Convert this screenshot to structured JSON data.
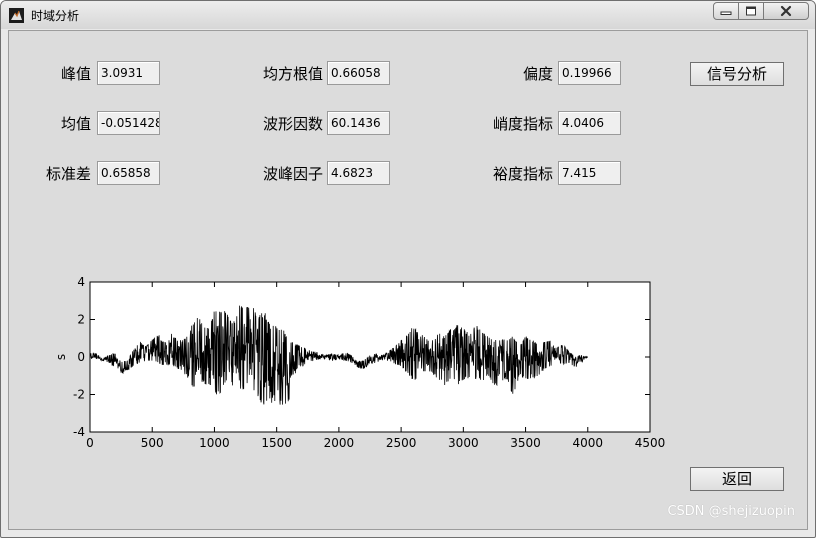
{
  "window": {
    "title": "时域分析"
  },
  "metrics": [
    {
      "label": "峰值",
      "value": "3.0931"
    },
    {
      "label": "均方根值",
      "value": "0.66058"
    },
    {
      "label": "偏度",
      "value": "0.19966"
    },
    {
      "label": "均值",
      "value": "-0.051428"
    },
    {
      "label": "波形因数",
      "value": "60.1436"
    },
    {
      "label": "峭度指标",
      "value": "4.0406"
    },
    {
      "label": "标准差",
      "value": "0.65858"
    },
    {
      "label": "波峰因子",
      "value": "4.6823"
    },
    {
      "label": "裕度指标",
      "value": "7.415"
    }
  ],
  "buttons": {
    "analyze": "信号分析",
    "back": "返回"
  },
  "watermark": "CSDN @shejizuopin",
  "chart_data": {
    "type": "line",
    "ylabel": "s",
    "xlim": [
      0,
      4500
    ],
    "ylim": [
      -4,
      4
    ],
    "x_ticks": [
      0,
      500,
      1000,
      1500,
      2000,
      2500,
      3000,
      3500,
      4000,
      4500
    ],
    "y_ticks": [
      4,
      2,
      0,
      -2,
      -4
    ],
    "x_tick_labels": [
      "0",
      "500",
      "1000",
      "1500",
      "2000",
      "2500",
      "3000",
      "3500",
      "4000",
      "4500"
    ],
    "y_tick_labels": [
      "4",
      "2",
      "0",
      "-2",
      "-4"
    ],
    "grid": false,
    "series": [
      {
        "color": "#000000",
        "x": [
          0,
          50,
          100,
          150,
          200,
          250,
          300,
          350,
          400,
          450,
          500,
          550,
          600,
          650,
          700,
          750,
          800,
          850,
          900,
          950,
          1000,
          1050,
          1100,
          1150,
          1200,
          1250,
          1300,
          1350,
          1400,
          1450,
          1500,
          1550,
          1600,
          1650,
          1700,
          1750,
          1800,
          1850,
          1900,
          1950,
          2000,
          2050,
          2100,
          2150,
          2200,
          2250,
          2300,
          2350,
          2400,
          2450,
          2500,
          2550,
          2600,
          2650,
          2700,
          2750,
          2800,
          2850,
          2900,
          2950,
          3000,
          3050,
          3100,
          3150,
          3200,
          3250,
          3300,
          3350,
          3400,
          3450,
          3500,
          3550,
          3600,
          3650,
          3700,
          3750,
          3800,
          3850,
          3900,
          3950,
          4000
        ],
        "y_upper": [
          0.2,
          0.2,
          -0.1,
          0.1,
          0.2,
          -0.3,
          -0.2,
          0.4,
          0.9,
          0.6,
          1.0,
          1.2,
          0.8,
          1.3,
          1.0,
          0.9,
          1.5,
          2.2,
          2.0,
          1.5,
          2.5,
          2.6,
          2.4,
          1.8,
          2.8,
          3.1,
          2.9,
          2.2,
          2.5,
          1.7,
          1.8,
          1.5,
          0.9,
          0.7,
          0.6,
          0.4,
          0.3,
          0.2,
          0.1,
          0.2,
          0.1,
          0.3,
          0.1,
          -0.3,
          -0.2,
          0.1,
          0.2,
          0.1,
          0.3,
          0.6,
          0.9,
          1.2,
          1.7,
          1.3,
          1.0,
          0.9,
          1.3,
          1.1,
          1.5,
          1.9,
          1.6,
          1.2,
          1.8,
          1.4,
          1.1,
          0.9,
          1.0,
          0.9,
          1.2,
          0.6,
          1.1,
          1.0,
          0.7,
          0.8,
          0.9,
          0.5,
          0.7,
          0.3,
          0.0,
          0.1,
          0.0
        ],
        "y_lower": [
          -0.1,
          -0.1,
          -0.2,
          -0.3,
          -0.6,
          -0.9,
          -0.8,
          -0.5,
          -0.3,
          -0.2,
          -0.2,
          -0.3,
          -0.5,
          -0.4,
          -0.6,
          -0.9,
          -1.2,
          -2.0,
          -1.4,
          -1.5,
          -2.1,
          -1.9,
          -1.2,
          -1.6,
          -2.0,
          -1.6,
          -1.7,
          -2.2,
          -2.7,
          -2.5,
          -2.3,
          -2.8,
          -2.5,
          -1.0,
          -0.6,
          -0.3,
          -0.2,
          -0.1,
          -0.1,
          -0.2,
          -0.1,
          -0.2,
          -0.3,
          -0.6,
          -0.7,
          -0.4,
          -0.3,
          -0.2,
          -0.2,
          -0.4,
          -0.5,
          -0.9,
          -1.3,
          -1.0,
          -0.8,
          -0.9,
          -1.2,
          -1.6,
          -1.1,
          -1.5,
          -1.3,
          -1.1,
          -1.2,
          -1.4,
          -1.0,
          -1.6,
          -1.4,
          -1.2,
          -2.1,
          -1.0,
          -1.3,
          -1.3,
          -1.0,
          -0.7,
          -0.5,
          -0.3,
          -0.4,
          -0.3,
          -0.6,
          -0.3,
          0.0
        ]
      }
    ]
  }
}
